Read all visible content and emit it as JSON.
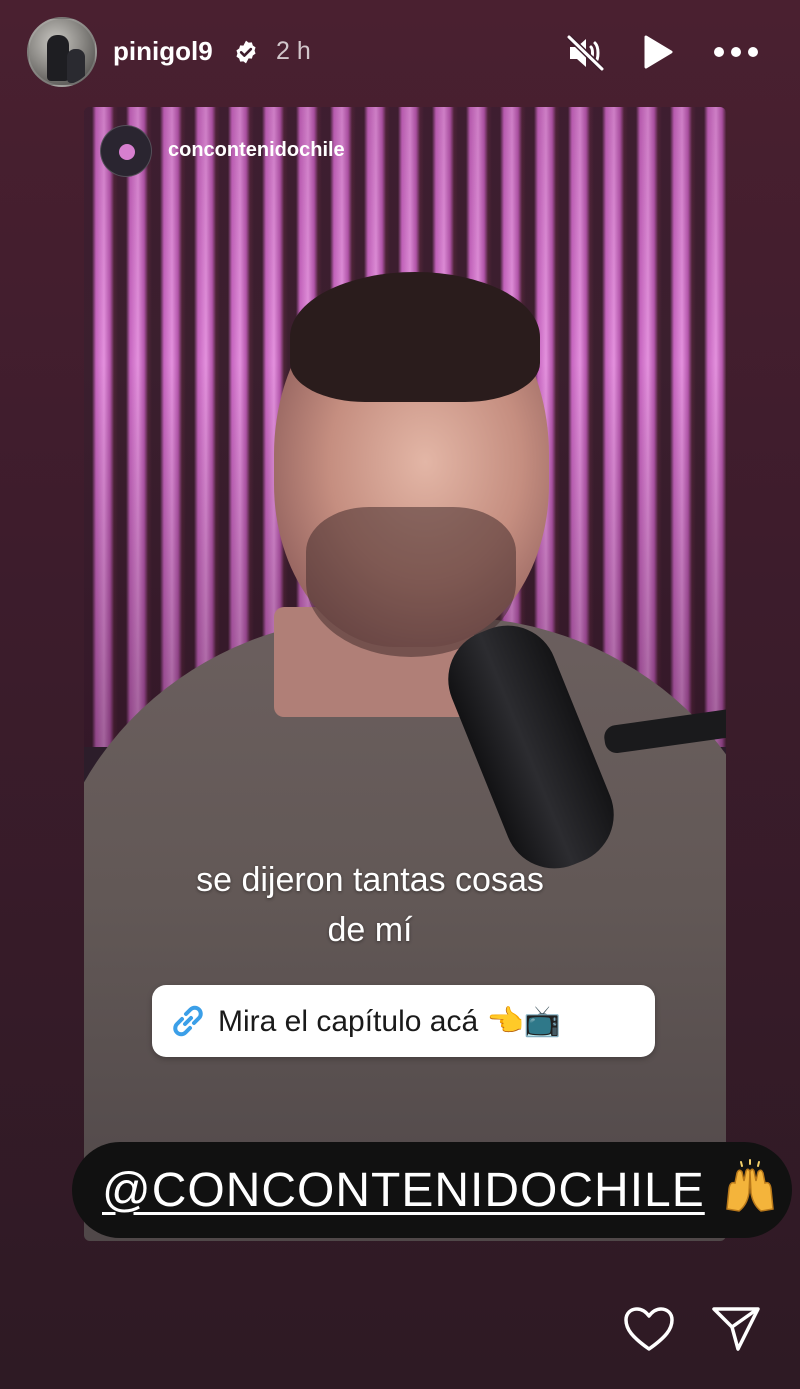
{
  "header": {
    "username": "pinigol9",
    "time": "2 h",
    "icons": [
      "verified-badge-icon",
      "muted-speaker-icon",
      "play-icon",
      "more-options-icon"
    ]
  },
  "story": {
    "embedded_account": "concontenidochile",
    "caption_line1": "se dijeron tantas cosas",
    "caption_line2": "de mí",
    "link_sticker": {
      "label": "Mira el capítulo acá 👈📺",
      "icon": "link-icon"
    },
    "mention": {
      "label": "@CONCONTENIDOCHILE",
      "emoji": "raising-hands-icon"
    }
  },
  "footer": {
    "icons": [
      "heart-icon",
      "send-icon"
    ]
  },
  "colors": {
    "background": "#3d1c2c",
    "accent_purple": "#d77fcf",
    "link_blue": "#3b9fe8",
    "sticker_dark": "#111111"
  }
}
